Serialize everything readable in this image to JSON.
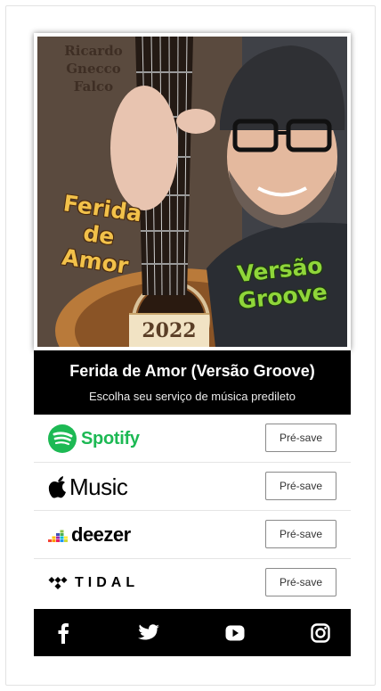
{
  "cover": {
    "artist": "Ricardo Gnecco Falco",
    "title_left": "Ferida de Amor",
    "title_right": "Versão Groove",
    "year": "2022"
  },
  "banner": {
    "title": "Ferida de Amor (Versão Groove)",
    "subtitle": "Escolha seu serviço de música predileto"
  },
  "services": [
    {
      "name": "Spotify",
      "button": "Pré-save"
    },
    {
      "name": "Music",
      "button": "Pré-save"
    },
    {
      "name": "deezer",
      "button": "Pré-save"
    },
    {
      "name": "TIDAL",
      "button": "Pré-save"
    }
  ],
  "social": [
    "facebook-icon",
    "twitter-icon",
    "youtube-icon",
    "instagram-icon"
  ],
  "colors": {
    "spotify": "#1db954",
    "banner": "#000000",
    "social_bar": "#000000"
  }
}
